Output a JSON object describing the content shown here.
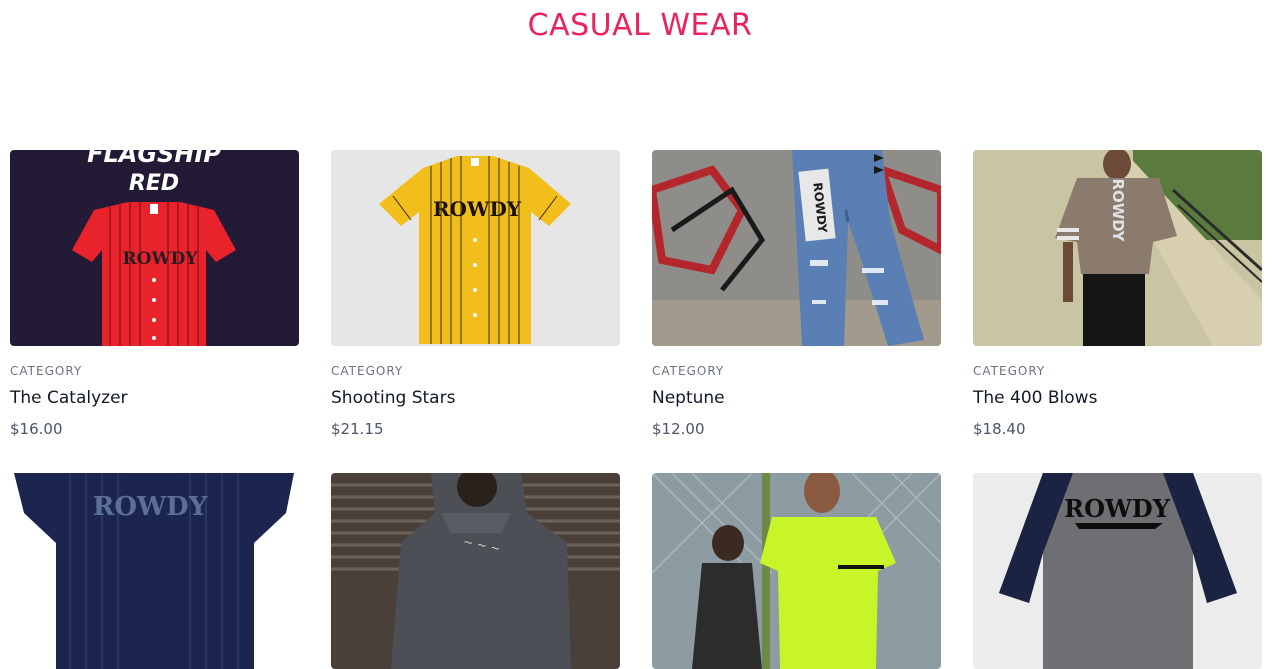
{
  "section": {
    "title": "CASUAL WEAR"
  },
  "products": [
    {
      "category": "CATEGORY",
      "name": "The Catalyzer",
      "price": "$16.00",
      "image": "red-pinstripe-jersey",
      "bg_color": "#231a35",
      "shirt_color": "#e8232b",
      "print_text": "ROWDY",
      "banner_text_1": "FLAGSHIP",
      "banner_text_2": "RED"
    },
    {
      "category": "CATEGORY",
      "name": "Shooting Stars",
      "price": "$21.15",
      "image": "yellow-pinstripe-jersey",
      "bg_color": "#e6e6e6",
      "shirt_color": "#f2be1c",
      "print_text": "ROWDY"
    },
    {
      "category": "CATEGORY",
      "name": "Neptune",
      "price": "$12.00",
      "image": "ripped-denim-jeans",
      "bg_color": "#8f8d89",
      "shirt_color": "#5a7fb5",
      "print_text": "ROWDY"
    },
    {
      "category": "CATEGORY",
      "name": "The 400 Blows",
      "price": "$18.40",
      "image": "brown-oversized-tee",
      "bg_color": "#c9c4a1",
      "shirt_color": "#8b7a6e",
      "print_text": "ROWDY"
    },
    {
      "image": "navy-pinstripe-jersey",
      "bg_color": "#ffffff",
      "shirt_color": "#1b2550",
      "print_text": "ROWDY"
    },
    {
      "image": "grey-hoodie",
      "bg_color": "#4a4039",
      "shirt_color": "#4d4f57"
    },
    {
      "image": "neon-green-tee",
      "bg_color": "#8d9ba3",
      "shirt_color": "#c8f528"
    },
    {
      "image": "navy-raglan-tee",
      "bg_color": "#ececec",
      "shirt_color": "#6f6f73",
      "print_text": "ROWDY"
    }
  ]
}
